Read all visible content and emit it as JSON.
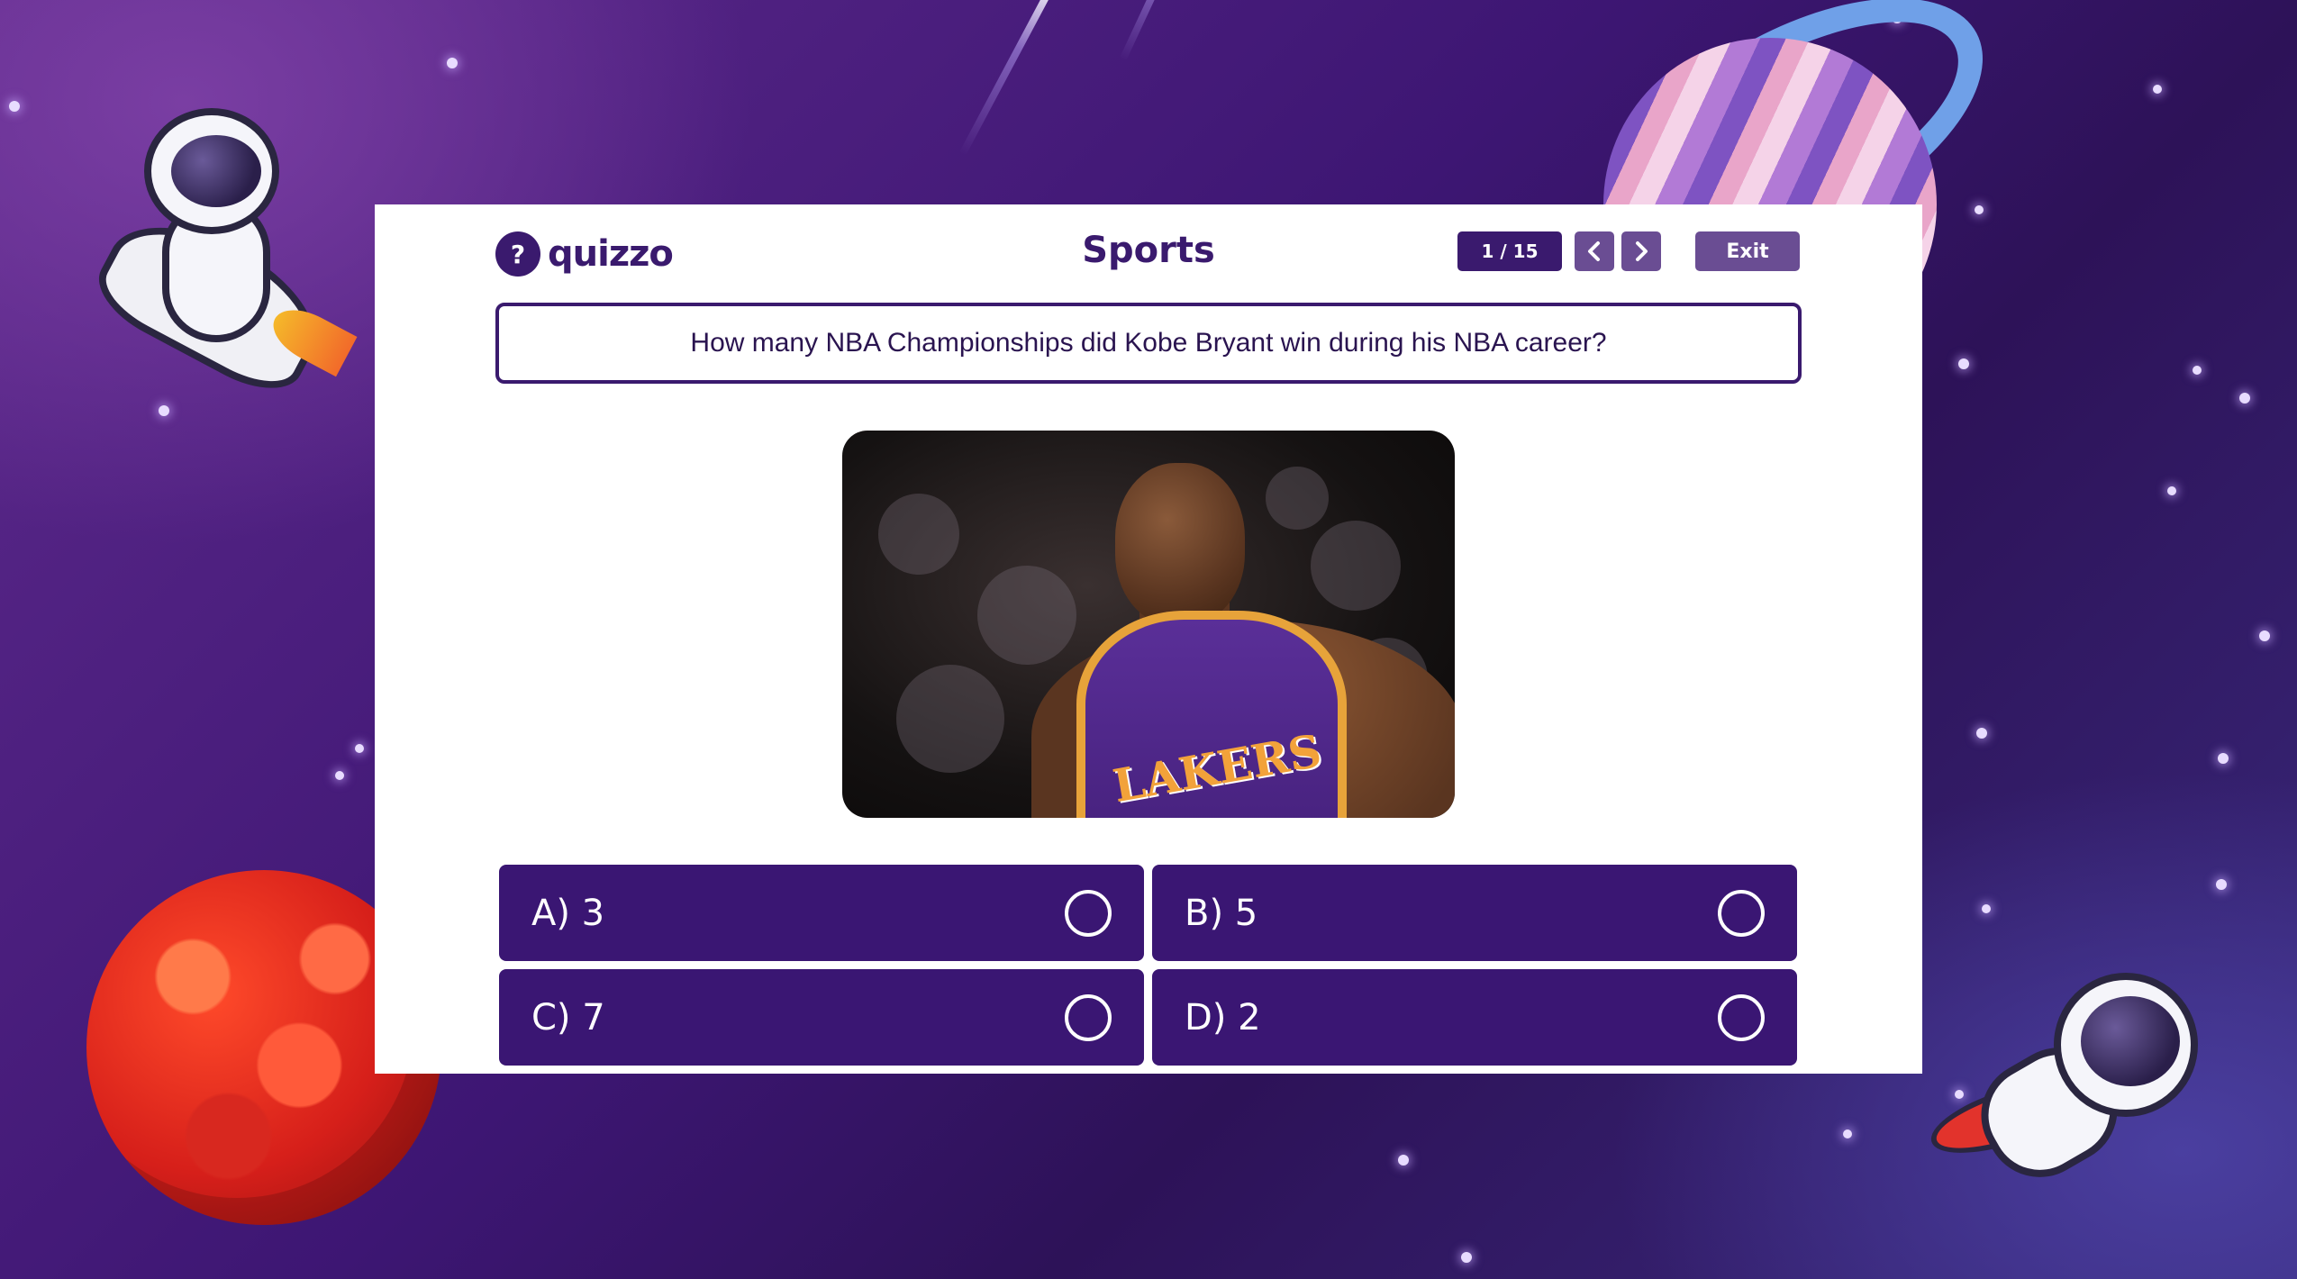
{
  "app": {
    "logo_text": "quizzo",
    "logo_icon": "question-mark-icon"
  },
  "header": {
    "category": "Sports",
    "counter": "1 / 15",
    "prev_icon": "chevron-left-icon",
    "next_icon": "chevron-right-icon",
    "exit_label": "Exit"
  },
  "question": {
    "text": "How many NBA Championships did Kobe Bryant win during his NBA career?",
    "jersey_text": "LAKERS"
  },
  "answers": [
    {
      "label": "A)  3"
    },
    {
      "label": "B)  5"
    },
    {
      "label": "C)  7"
    },
    {
      "label": "D)  2"
    }
  ],
  "colors": {
    "primary": "#3a1673",
    "secondary": "#6a4d93",
    "background_from": "#5e2a8c",
    "background_to": "#3a2a7d"
  }
}
